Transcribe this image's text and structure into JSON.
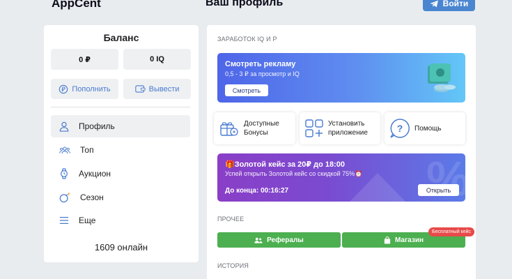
{
  "header": {
    "brand": "AppCent",
    "page_title": "Ваш профиль",
    "login_label": "Войти"
  },
  "sidebar": {
    "balance_title": "Баланс",
    "rub_balance": "0 ₽",
    "iq_balance": "0 IQ",
    "deposit_label": "Пополнить",
    "withdraw_label": "Вывести",
    "nav": [
      {
        "label": "Профиль",
        "icon": "user-icon",
        "active": true
      },
      {
        "label": "Топ",
        "icon": "users-icon",
        "active": false
      },
      {
        "label": "Аукцион",
        "icon": "watch-icon",
        "active": false
      },
      {
        "label": "Сезон",
        "icon": "bomb-icon",
        "active": false
      },
      {
        "label": "Еще",
        "icon": "menu-icon",
        "active": false
      }
    ],
    "online_text": "1609 онлайн"
  },
  "main": {
    "earn_label": "ЗАРАБОТОК IQ И Р",
    "ad_card": {
      "title": "Смотреть рекламу",
      "subtitle": "0,5 - 3 ₽ за просмотр и IQ",
      "button": "Смотреть"
    },
    "tiles": [
      {
        "label_line1": "Доступные",
        "label_line2": "Бонусы",
        "icon": "gift-icon"
      },
      {
        "label_line1": "Установить",
        "label_line2": "приложение",
        "icon": "apps-icon"
      },
      {
        "label_line1": "Помощь",
        "label_line2": "",
        "icon": "help-icon"
      }
    ],
    "gold_card": {
      "title": "🎁Золотой кейс за 20₽ до 18:00",
      "subtitle": "Успей открыть Золотой кейс со скидкой 75%⏰",
      "timer": "До конца: 00:16:27",
      "button": "Открыть"
    },
    "other_label": "ПРОЧЕЕ",
    "referrals_label": "Рефералы",
    "shop_label": "Магазин",
    "shop_badge": "Бесплатный кейс",
    "history_label": "ИСТОРИЯ"
  },
  "colors": {
    "accent": "#4a86d0",
    "green": "#4caf50",
    "badge": "#e84a4a",
    "bg": "#e9ecef"
  }
}
